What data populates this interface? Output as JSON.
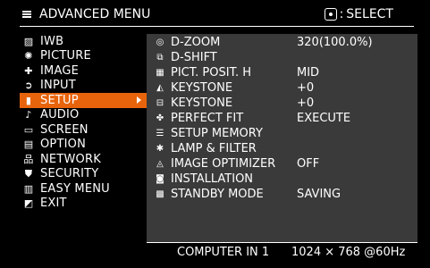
{
  "header": {
    "title": "ADVANCED MENU",
    "select_hint": "SELECT",
    "select_prefix": ":"
  },
  "menu": {
    "items": [
      {
        "label": "IWB",
        "icon": "iwb-icon"
      },
      {
        "label": "PICTURE",
        "icon": "picture-icon"
      },
      {
        "label": "IMAGE",
        "icon": "image-icon"
      },
      {
        "label": "INPUT",
        "icon": "input-icon"
      },
      {
        "label": "SETUP",
        "icon": "setup-icon",
        "selected": true
      },
      {
        "label": "AUDIO",
        "icon": "audio-icon"
      },
      {
        "label": "SCREEN",
        "icon": "screen-icon"
      },
      {
        "label": "OPTION",
        "icon": "option-icon"
      },
      {
        "label": "NETWORK",
        "icon": "network-icon"
      },
      {
        "label": "SECURITY",
        "icon": "security-icon"
      },
      {
        "label": "EASY MENU",
        "icon": "easy-menu-icon"
      },
      {
        "label": "EXIT",
        "icon": "exit-icon"
      }
    ]
  },
  "setup": {
    "rows": [
      {
        "label": "D-ZOOM",
        "value": "320(100.0%)",
        "icon": "d-zoom-icon"
      },
      {
        "label": "D-SHIFT",
        "value": "",
        "icon": "d-shift-icon"
      },
      {
        "label": "PICT. POSIT. H",
        "value": "MID",
        "icon": "pict-posit-icon"
      },
      {
        "label": "KEYSTONE",
        "value": "+0",
        "icon": "keystone-vertical-icon"
      },
      {
        "label": "KEYSTONE",
        "value": "+0",
        "icon": "keystone-horizontal-icon"
      },
      {
        "label": "PERFECT FIT",
        "value": "EXECUTE",
        "icon": "perfect-fit-icon"
      },
      {
        "label": "SETUP MEMORY",
        "value": "",
        "icon": "setup-memory-icon"
      },
      {
        "label": "LAMP & FILTER",
        "value": "",
        "icon": "lamp-filter-icon"
      },
      {
        "label": "IMAGE OPTIMIZER",
        "value": "OFF",
        "icon": "image-optimizer-icon"
      },
      {
        "label": "INSTALLATION",
        "value": "",
        "icon": "installation-icon"
      },
      {
        "label": "STANDBY MODE",
        "value": "SAVING",
        "icon": "standby-mode-icon"
      }
    ]
  },
  "footer": {
    "source": "COMPUTER IN 1",
    "resolution": "1024 × 768 @60Hz"
  },
  "colors": {
    "background": "#000000",
    "panel": "#3a3a3a",
    "highlight": "#e8640c",
    "text": "#ffffff"
  }
}
